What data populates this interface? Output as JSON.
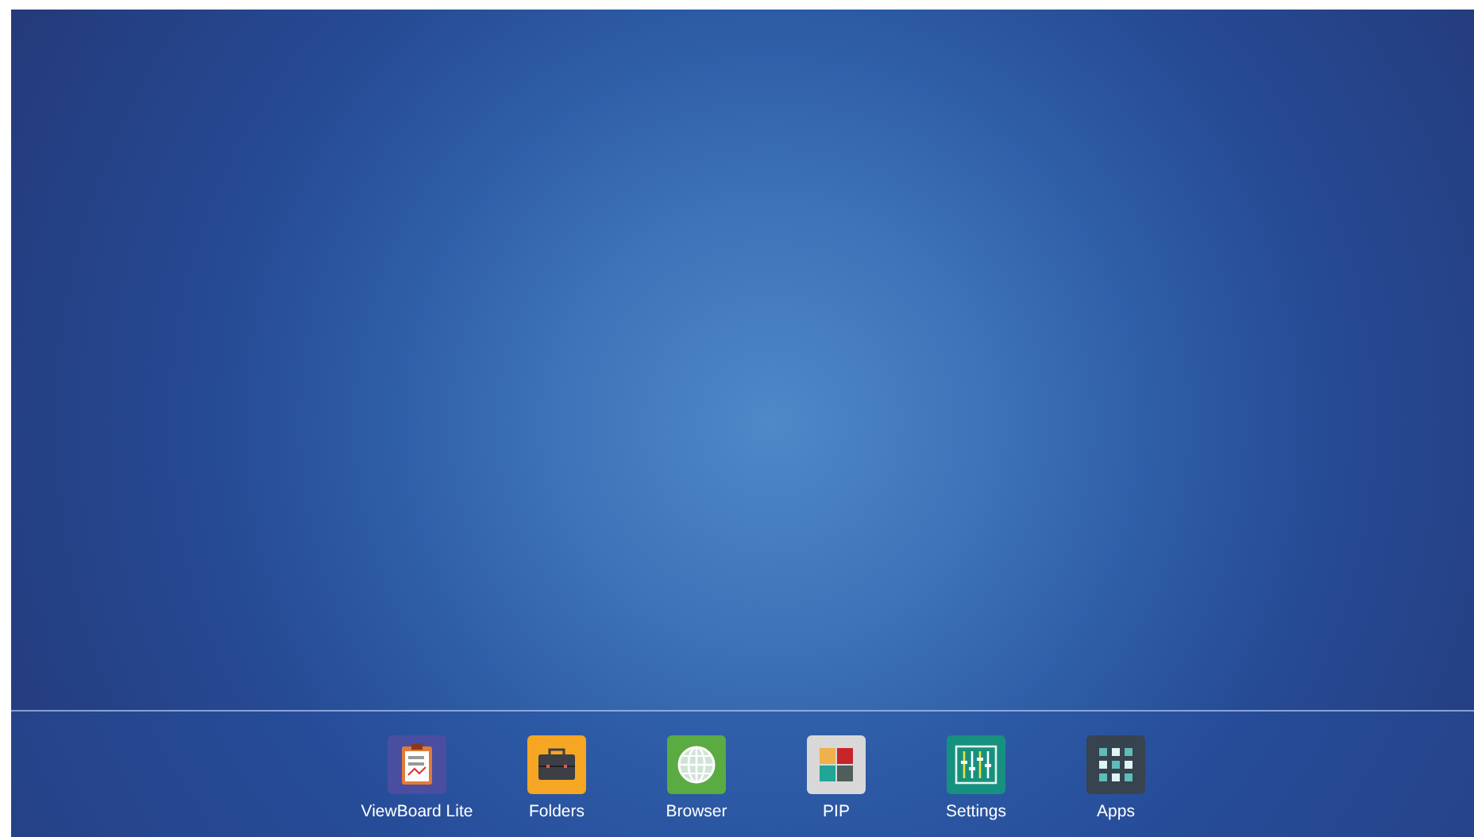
{
  "dock": {
    "apps": [
      {
        "kind": "clipboard",
        "label": "ViewBoard Lite"
      },
      {
        "kind": "briefcase",
        "label": "Folders"
      },
      {
        "kind": "globe",
        "label": "Browser"
      },
      {
        "kind": "pip",
        "label": "PIP"
      },
      {
        "kind": "sliders",
        "label": "Settings"
      },
      {
        "kind": "grid",
        "label": "Apps"
      }
    ]
  }
}
